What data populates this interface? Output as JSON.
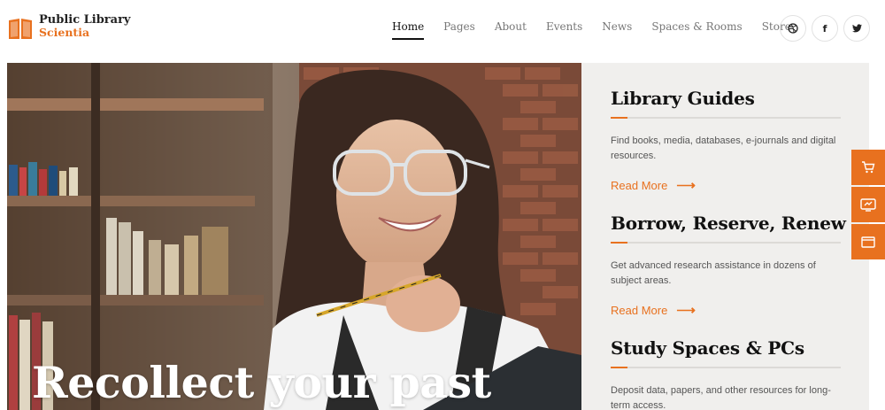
{
  "brand": {
    "line1": "Public Library",
    "line2": "Scientia",
    "icon": "open-book-icon",
    "accent_color": "#e8711f"
  },
  "nav": {
    "items": [
      {
        "label": "Home",
        "active": true
      },
      {
        "label": "Pages",
        "active": false
      },
      {
        "label": "About",
        "active": false
      },
      {
        "label": "Events",
        "active": false
      },
      {
        "label": "News",
        "active": false
      },
      {
        "label": "Spaces & Rooms",
        "active": false
      },
      {
        "label": "Store",
        "active": false
      }
    ]
  },
  "social": [
    {
      "icon": "dribbble-icon",
      "glyph": "◎"
    },
    {
      "icon": "facebook-icon",
      "glyph": "f"
    },
    {
      "icon": "twitter-icon",
      "glyph": "🐦"
    }
  ],
  "hero": {
    "title": "Recollect your past"
  },
  "guides": [
    {
      "title": "Library Guides",
      "text": "Find books, media, databases, e-journals and digital resources.",
      "link": "Read More"
    },
    {
      "title": "Borrow, Reserve, Renew",
      "text": "Get advanced research assistance in dozens of subject areas.",
      "link": "Read More"
    },
    {
      "title": "Study Spaces & PCs",
      "text": "Deposit data, papers, and other resources for long-term access.",
      "link": ""
    }
  ],
  "side_toolbar": [
    {
      "icon": "cart-icon"
    },
    {
      "icon": "demos-icon"
    },
    {
      "icon": "window-icon"
    }
  ]
}
